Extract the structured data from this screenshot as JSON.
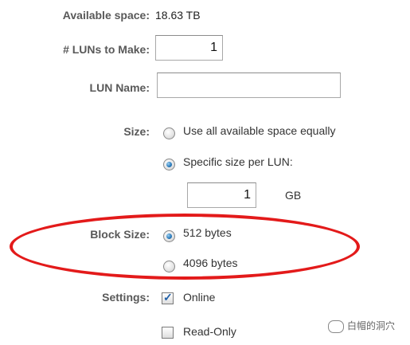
{
  "available_space": {
    "label": "Available space:",
    "value": "18.63 TB"
  },
  "luns_to_make": {
    "label": "# LUNs to Make:",
    "value": "1"
  },
  "lun_name": {
    "label": "LUN Name:",
    "value": ""
  },
  "size": {
    "label": "Size:",
    "options": [
      {
        "label": "Use all available space equally",
        "selected": false
      },
      {
        "label": "Specific size per LUN:",
        "selected": true
      }
    ],
    "specific_value": "1",
    "unit": "GB"
  },
  "block_size": {
    "label": "Block Size:",
    "options": [
      {
        "label": "512 bytes",
        "selected": true
      },
      {
        "label": "4096 bytes",
        "selected": false
      }
    ]
  },
  "settings": {
    "label": "Settings:",
    "options": [
      {
        "label": "Online",
        "checked": true
      },
      {
        "label": "Read-Only",
        "checked": false
      }
    ]
  },
  "annotation": {
    "color": "#e31a1a"
  },
  "watermark": {
    "icon": "wechat-icon",
    "text": "白帽的洞穴"
  }
}
